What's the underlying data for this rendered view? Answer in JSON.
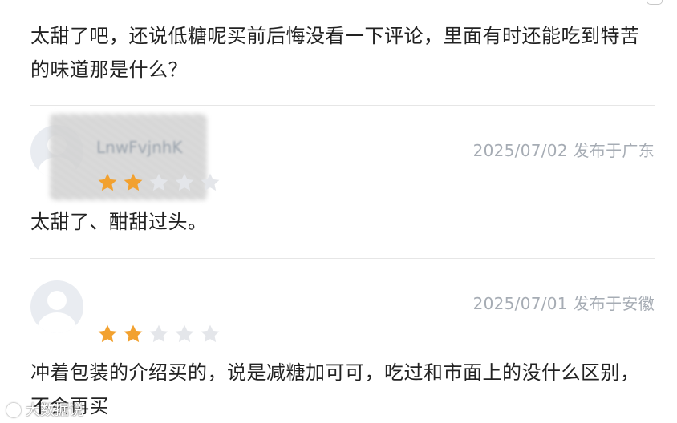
{
  "reviews": [
    {
      "text": "太甜了吧，还说低糖呢买前后悔没看一下评论，里面有时还能吃到特苦的味道那是什么？"
    },
    {
      "username": "LnwFvjnhK",
      "meta": "2025/07/02 发布于广东",
      "rating": 2,
      "text": "太甜了、酣甜过头。"
    },
    {
      "meta": "2025/07/01 发布于安徽",
      "rating": 2,
      "text": "冲着包装的介绍买的，说是减糖加可可，吃过和市面上的没什么区别，不会再买"
    }
  ],
  "star_max": 5,
  "colors": {
    "star_on": "#f2a12f",
    "star_off": "#e4e6ea"
  },
  "watermark": "大数据说"
}
